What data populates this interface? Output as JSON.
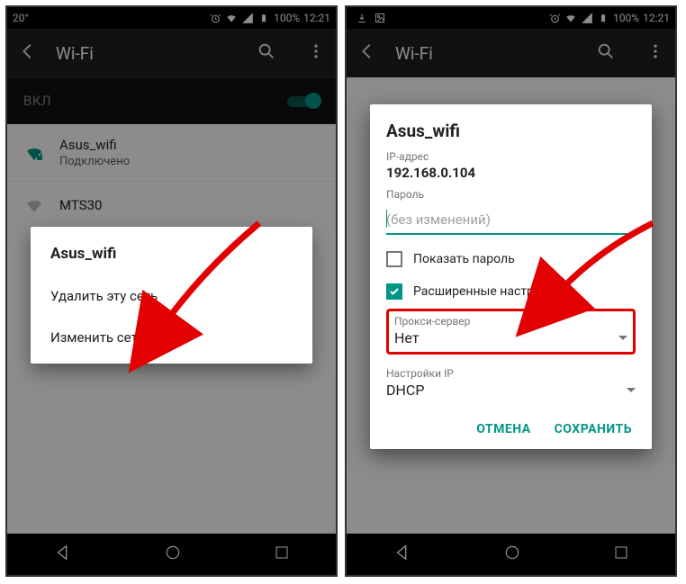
{
  "status": {
    "temp": "20°",
    "battery": "100%",
    "time": "12:21"
  },
  "appbar": {
    "title": "Wi-Fi"
  },
  "toggle": {
    "label": "ВКЛ"
  },
  "networks": [
    {
      "name": "Asus_wifi",
      "sub": "Подключено"
    },
    {
      "name": "MTS30",
      "sub": ""
    }
  ],
  "context_menu": {
    "title": "Asus_wifi",
    "items": [
      "Удалить эту сеть",
      "Изменить сеть"
    ]
  },
  "dialog": {
    "title": "Asus_wifi",
    "ip_label": "IP-адрес",
    "ip_value": "192.168.0.104",
    "password_label": "Пароль",
    "password_placeholder": "(без изменений)",
    "show_password": "Показать пароль",
    "advanced": "Расширенные настройки",
    "proxy_label": "Прокси-сервер",
    "proxy_value": "Нет",
    "ip_cfg_label": "Настройки IP",
    "ip_cfg_value": "DHCP",
    "cancel": "ОТМЕНА",
    "save": "СОХРАНИТЬ"
  }
}
